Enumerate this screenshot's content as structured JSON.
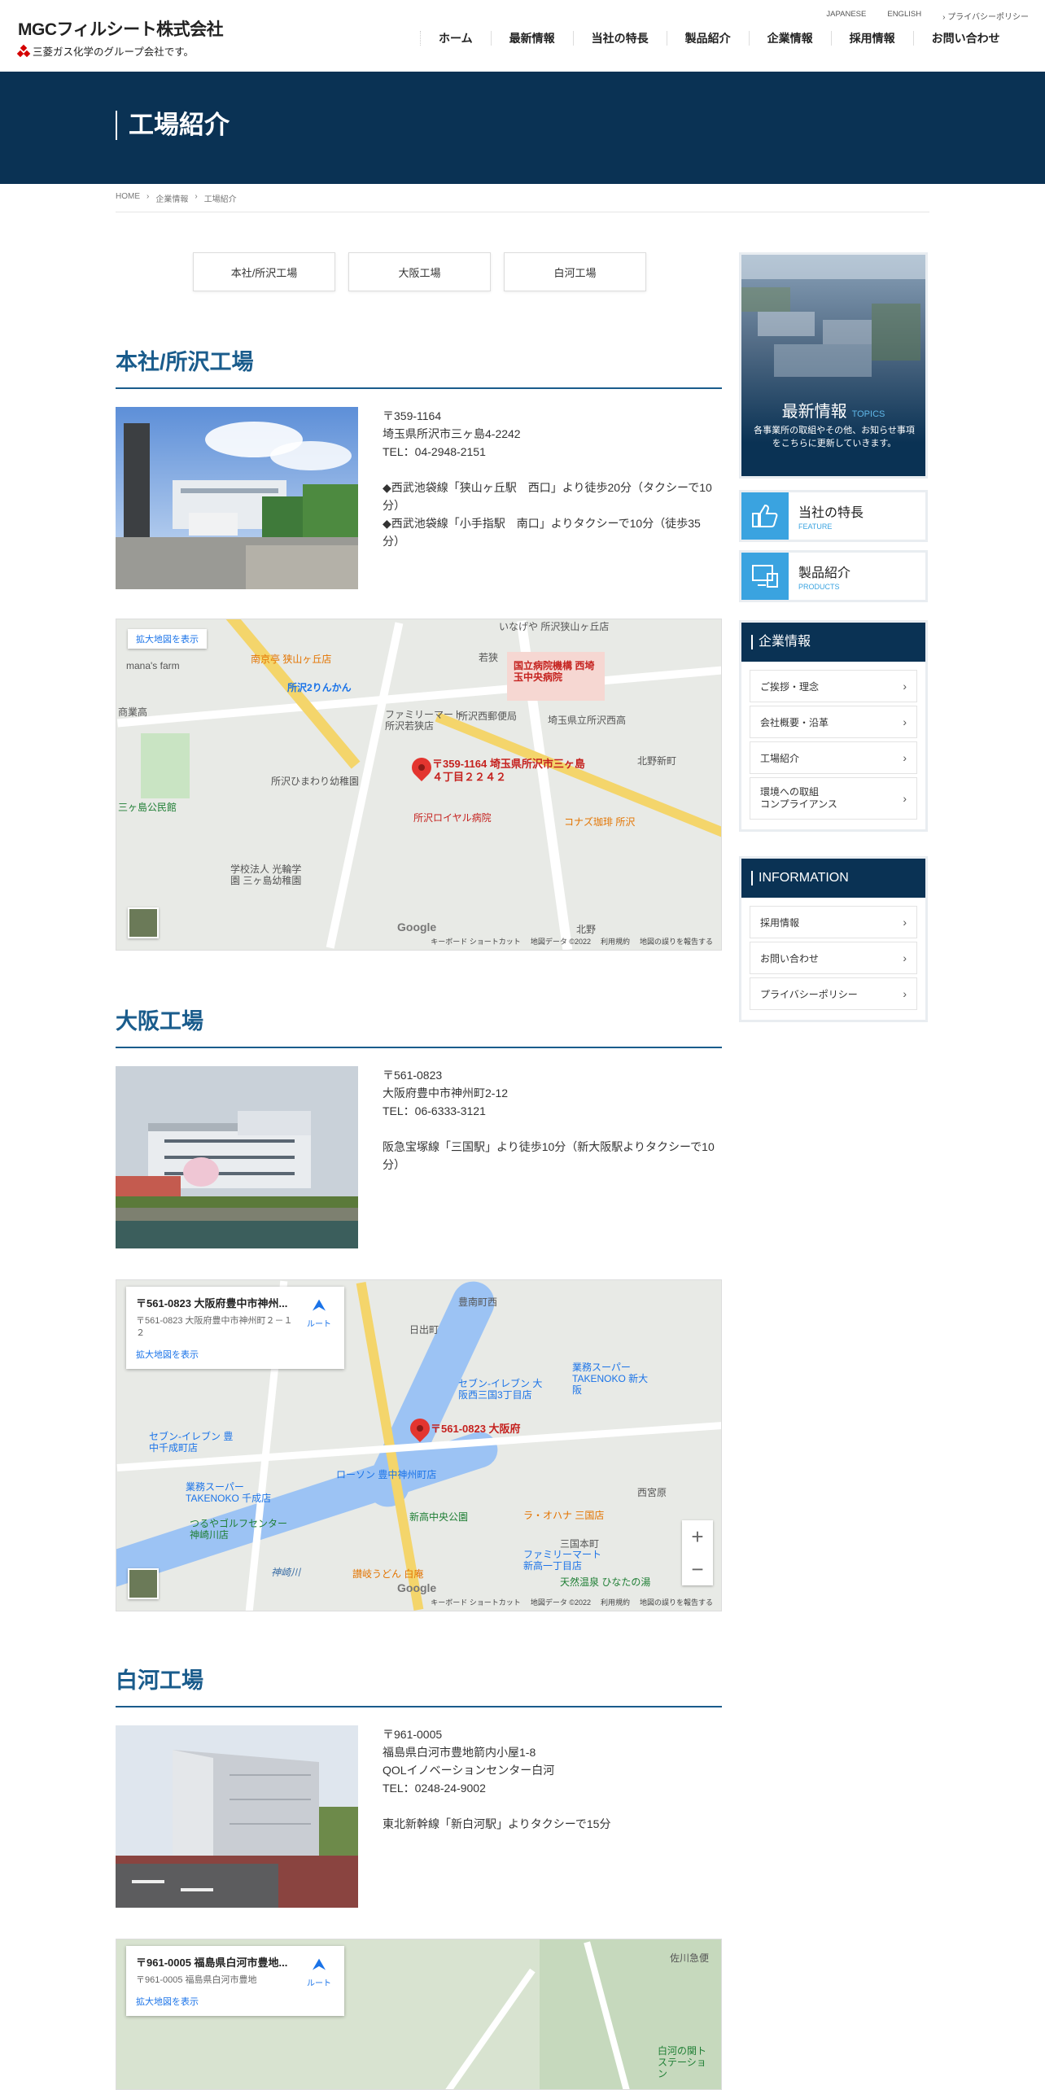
{
  "header": {
    "logo_main": "MGCフィルシート株式会社",
    "logo_sub": "三菱ガス化学のグループ会社です。",
    "top_links": {
      "japanese": "JAPANESE",
      "english": "ENGLISH",
      "privacy": "プライバシーポリシー"
    },
    "nav": [
      "ホーム",
      "最新情報",
      "当社の特長",
      "製品紹介",
      "企業情報",
      "採用情報",
      "お問い合わせ"
    ]
  },
  "hero": {
    "title": "工場紹介"
  },
  "breadcrumb": [
    "HOME",
    "企業情報",
    "工場紹介"
  ],
  "tabs": [
    "本社/所沢工場",
    "大阪工場",
    "白河工場"
  ],
  "factories": [
    {
      "title": "本社/所沢工場",
      "postal": "〒359-1164",
      "address": "埼玉県所沢市三ヶ島4-2242",
      "tel": "TEL：04-2948-2151",
      "access": [
        "◆西武池袋線「狭山ヶ丘駅　西口」より徒歩20分（タクシーで10分）",
        "◆西武池袋線「小手指駅　南口」よりタクシーで10分（徒歩35分）"
      ],
      "map": {
        "link": "拡大地図を表示",
        "pin_label": "〒359-1164 埼玉県所沢市三ヶ島４丁目２２４２",
        "footer": [
          "キーボード ショートカット",
          "地図データ ©2022",
          "利用規約",
          "地図の誤りを報告する"
        ],
        "labels": [
          "所沢2りんかん",
          "ファミリーマート 所沢若狭店",
          "国立病院機構 西埼玉中央病院",
          "所沢西郵便局",
          "埼玉県立所沢西高",
          "北野新町",
          "所沢ひまわり幼稚園",
          "所沢ロイヤル病院",
          "コナズ珈琲 所沢",
          "三ヶ島公民館",
          "学校法人 光輪学園 三ヶ島幼稚園",
          "北野",
          "若狭",
          "南京亭 狭山ヶ丘店",
          "mana's farm",
          "商業高",
          "いなげや 所沢狭山ヶ丘店"
        ]
      }
    },
    {
      "title": "大阪工場",
      "postal": "〒561-0823",
      "address": "大阪府豊中市神州町2-12",
      "tel": "TEL：06-6333-3121",
      "access": [
        "阪急宝塚線「三国駅」より徒歩10分（新大阪駅よりタクシーで10分）"
      ],
      "map": {
        "card_title": "〒561-0823 大阪府豊中市神州...",
        "card_address": "〒561-0823 大阪府豊中市神州町２－１２",
        "route": "ルート",
        "link": "拡大地図を表示",
        "pin_label": "〒561-0823 大阪府",
        "footer": [
          "キーボード ショートカット",
          "地図データ ©2022",
          "利用規約",
          "地図の誤りを報告する"
        ],
        "labels": [
          "豊南町西",
          "日出町",
          "業務スーパー TAKENOKO 新大阪",
          "セブン-イレブン 大阪西三国3丁目店",
          "セブン-イレブン 豊中千成町店",
          "ローソン 豊中神州町店",
          "業務スーパー TAKENOKO 千成店",
          "新高中央公園",
          "つるやゴルフセンター 神崎川店",
          "ラ・オハナ 三国店",
          "三国本町",
          "ファミリーマート 新高一丁目店",
          "讃岐うどん 白庵",
          "天然温泉 ひなたの湯",
          "西宮原",
          "神崎川"
        ]
      }
    },
    {
      "title": "白河工場",
      "postal": "〒961-0005",
      "address": "福島県白河市豊地箭内小屋1-8",
      "facility": "QOLイノベーションセンター白河",
      "tel": "TEL：0248-24-9002",
      "access": [
        "東北新幹線「新白河駅」よりタクシーで15分"
      ],
      "map": {
        "card_title": "〒961-0005 福島県白河市豊地...",
        "card_address": "〒961-0005 福島県白河市豊地",
        "route": "ルート",
        "link": "拡大地図を表示",
        "labels": [
          "佐川急便",
          "白河の関トステーション"
        ]
      }
    }
  ],
  "sidebar": {
    "topics": {
      "title": "最新情報",
      "sub": "TOPICS",
      "desc": "各事業所の取組やその他、お知らせ事項をこちらに更新していきます。"
    },
    "feature": {
      "title": "当社の特長",
      "sub": "FEATURE"
    },
    "products": {
      "title": "製品紹介",
      "sub": "PRODUCTS"
    },
    "company": {
      "title": "企業情報",
      "items": [
        "ご挨拶・理念",
        "会社概要・沿革",
        "工場紹介",
        "環境への取組\nコンプライアンス"
      ]
    },
    "information": {
      "title": "INFORMATION",
      "items": [
        "採用情報",
        "お問い合わせ",
        "プライバシーポリシー"
      ]
    }
  },
  "colors": {
    "navy": "#0a3254",
    "section_blue": "#1a5c8c",
    "accent": "#3aa3e0",
    "pin": "#e3352f"
  }
}
